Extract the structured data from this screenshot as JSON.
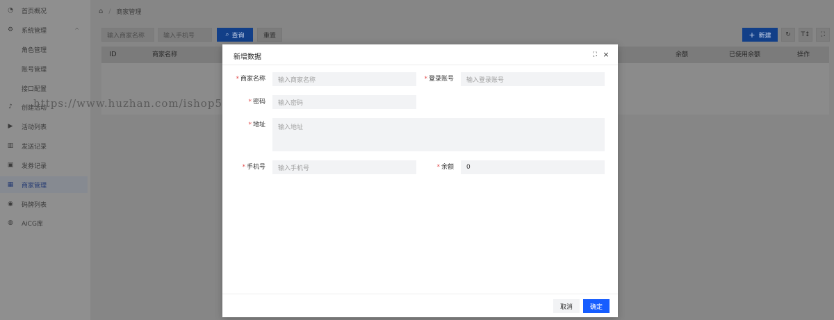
{
  "sidebar": {
    "items": [
      {
        "label": "首页概况",
        "icon": "dashboard-icon"
      },
      {
        "label": "系统管理",
        "icon": "gear-icon"
      },
      {
        "label": "角色管理"
      },
      {
        "label": "账号管理"
      },
      {
        "label": "接口配置"
      },
      {
        "label": "创建活动",
        "icon": "tiktok-icon"
      },
      {
        "label": "活动列表",
        "icon": "play-icon"
      },
      {
        "label": "发送记录",
        "icon": "bar-chart-icon"
      },
      {
        "label": "发券记录",
        "icon": "coupon-icon"
      },
      {
        "label": "商家管理",
        "icon": "store-icon"
      },
      {
        "label": "码牌列表",
        "icon": "qrcode-icon"
      },
      {
        "label": "AiCG库",
        "icon": "ai-icon"
      }
    ],
    "caret": "^",
    "active_color": "#243a72"
  },
  "breadcrumb": {
    "home_icon": "⌂",
    "separator": "/",
    "current": "商家管理"
  },
  "filters": {
    "merchant_placeholder": "输入商家名称",
    "phone_placeholder": "输入手机号",
    "query_label": "查询",
    "reset_label": "重置",
    "new_label": "新建",
    "search_icon": "⌕",
    "plus_icon": "+"
  },
  "toolbar_icons": {
    "refresh": "↻",
    "density": "T↕",
    "fullscreen": "⛶"
  },
  "table": {
    "headers": [
      "ID",
      "商家名称",
      "余额",
      "已使用余额",
      "操作"
    ]
  },
  "watermark": "https://www.huzhan.com/ishop5534",
  "modal": {
    "title": "新增数据",
    "fullscreen_icon": "⛶",
    "close_icon": "×",
    "fields": {
      "merchant_name": {
        "label": "商家名称",
        "placeholder": "输入商家名称",
        "required": "*"
      },
      "login_account": {
        "label": "登录账号",
        "placeholder": "输入登录账号",
        "required": "*"
      },
      "password": {
        "label": "密码",
        "placeholder": "输入密码",
        "required": "*"
      },
      "address": {
        "label": "地址",
        "placeholder": "输入地址",
        "required": "*"
      },
      "phone": {
        "label": "手机号",
        "placeholder": "输入手机号",
        "required": "*"
      },
      "balance": {
        "label": "余额",
        "value": "0",
        "required": "*"
      }
    },
    "cancel_label": "取消",
    "ok_label": "确定",
    "primary_color": "#165dff"
  }
}
